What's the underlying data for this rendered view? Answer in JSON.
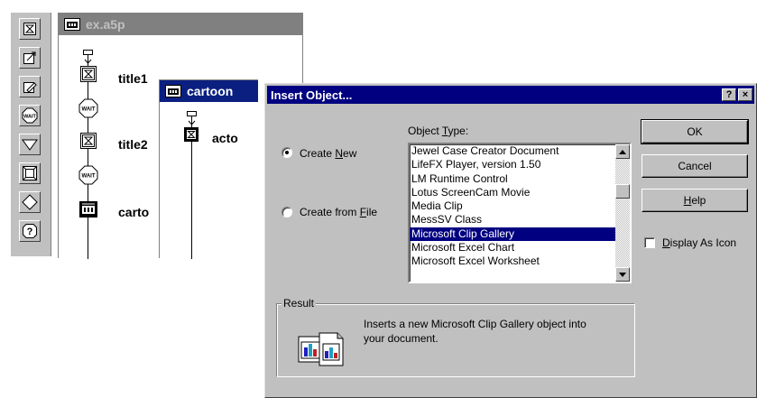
{
  "palette": {
    "icons": [
      "display-icon",
      "motion-icon",
      "erase-icon",
      "wait-icon",
      "decision-icon",
      "interaction-icon",
      "calculation-icon",
      "map-icon"
    ]
  },
  "main_window": {
    "title": "ex.a5p",
    "items": [
      {
        "label": "title1",
        "icon": "display-icon"
      },
      {
        "label": "WAIT",
        "icon": "wait-icon"
      },
      {
        "label": "title2",
        "icon": "display-icon"
      },
      {
        "label": "WAIT",
        "icon": "wait-icon"
      },
      {
        "label": "carto",
        "icon": "map-icon"
      }
    ]
  },
  "sub_window": {
    "title": "cartoon",
    "items": [
      {
        "label": "acto",
        "icon": "display-icon"
      }
    ]
  },
  "dialog": {
    "title": "Insert Object...",
    "help_button": "?",
    "close_button": "×",
    "object_type_label_pre": "Object ",
    "object_type_label_u": "T",
    "object_type_label_post": "ype:",
    "radio_new_pre": "Create ",
    "radio_new_u": "N",
    "radio_new_post": "ew",
    "radio_file_pre": "Create from ",
    "radio_file_u": "F",
    "radio_file_post": "ile",
    "selected_radio": "create-new",
    "object_types": [
      "Jewel Case Creator Document",
      "LifeFX Player, version 1.50",
      "LM Runtime Control",
      "Lotus ScreenCam Movie",
      "Media Clip",
      "MessSV Class",
      "Microsoft Clip Gallery",
      "Microsoft Excel Chart",
      "Microsoft Excel Worksheet"
    ],
    "selected_index": 6,
    "ok_label": "OK",
    "cancel_label": "Cancel",
    "help_label_u": "H",
    "help_label_post": "elp",
    "display_icon_u": "D",
    "display_icon_post": "isplay As Icon",
    "display_as_icon_checked": false,
    "result_label": "Result",
    "result_text_1": "Inserts a new Microsoft Clip Gallery object into",
    "result_text_2": "your document."
  },
  "colors": {
    "title_active": "#000080",
    "title_inactive": "#808080",
    "face": "#c0c0c0"
  }
}
